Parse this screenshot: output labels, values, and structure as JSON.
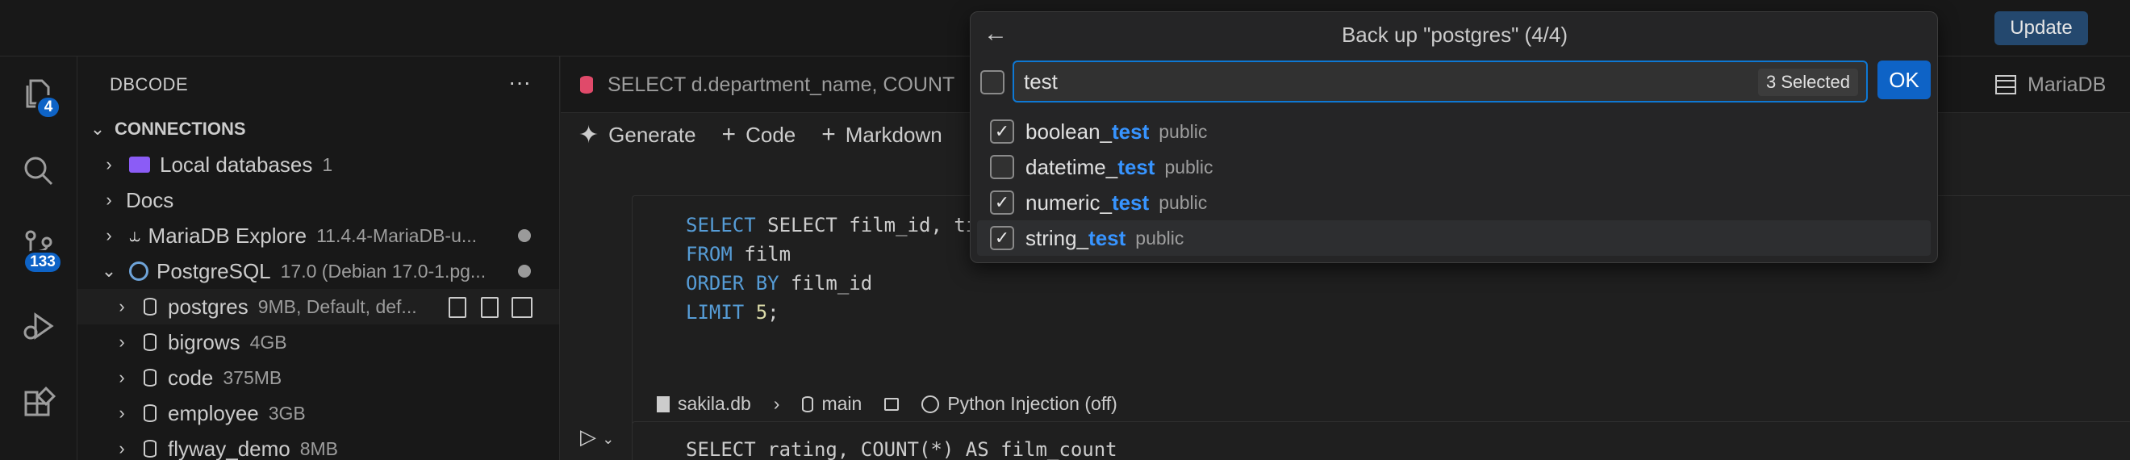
{
  "titlebar": {
    "update_label": "Update"
  },
  "activity": {
    "explorer_badge": "4",
    "scm_badge": "133"
  },
  "sidebar": {
    "title": "DBCODE",
    "more_label": "···",
    "section": "CONNECTIONS",
    "items": [
      {
        "label": "Local databases",
        "desc": "1",
        "icon": "folder-icon"
      },
      {
        "label": "Docs",
        "desc": ""
      },
      {
        "label": "MariaDB Explore",
        "desc": "11.4.4-MariaDB-u...",
        "icon": "mariadb-icon"
      },
      {
        "label": "PostgreSQL",
        "desc": "17.0 (Debian 17.0-1.pg...",
        "icon": "postgres-icon"
      }
    ],
    "databases": [
      {
        "label": "postgres",
        "desc": "9MB, Default, def..."
      },
      {
        "label": "bigrows",
        "desc": "4GB"
      },
      {
        "label": "code",
        "desc": "375MB"
      },
      {
        "label": "employee",
        "desc": "3GB"
      },
      {
        "label": "flyway_demo",
        "desc": "8MB"
      }
    ]
  },
  "editor": {
    "tab_query": "SELECT d.department_name, COUNT",
    "tab_right": "MariaDB",
    "toolbar": {
      "generate": "Generate",
      "code": "Code",
      "markdown": "Markdown"
    },
    "cell1": {
      "lines": [
        "SELECT film_id, title, ra",
        "FROM film",
        "ORDER BY film_id",
        "LIMIT 5;"
      ],
      "status": {
        "db": "sakila.db",
        "schema": "main",
        "injection": "Python Injection (off)"
      }
    },
    "cell2": {
      "line": "SELECT rating, COUNT(*) AS film_count"
    }
  },
  "quickpick": {
    "title": "Back up \"postgres\" (4/4)",
    "input_value": "test",
    "selected_count": "3 Selected",
    "ok_label": "OK",
    "items": [
      {
        "prefix": "boolean_",
        "match": "test",
        "desc": "public",
        "checked": true
      },
      {
        "prefix": "datetime_",
        "match": "test",
        "desc": "public",
        "checked": false
      },
      {
        "prefix": "numeric_",
        "match": "test",
        "desc": "public",
        "checked": true
      },
      {
        "prefix": "string_",
        "match": "test",
        "desc": "public",
        "checked": true
      }
    ]
  }
}
